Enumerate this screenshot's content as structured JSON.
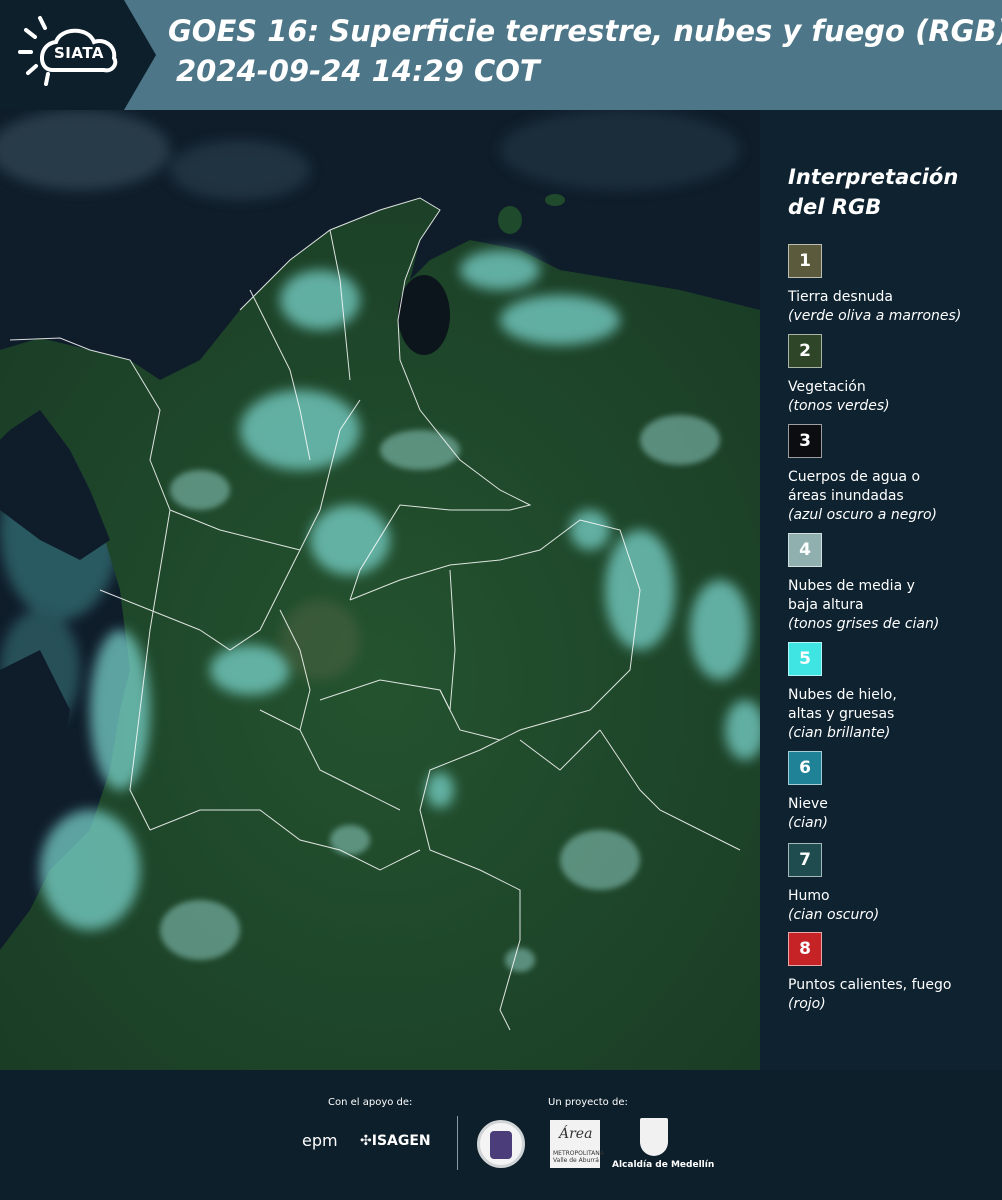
{
  "header": {
    "title_line1": "GOES 16: Superficie terrestre, nubes y fuego (RGB)",
    "title_line2": "2024-09-24 14:29 COT",
    "logo_text": "SIATA",
    "background_color": "#4d7788"
  },
  "legend": {
    "title": "Interpretación del RGB",
    "items": [
      {
        "number": "1",
        "label": "Tierra desnuda",
        "desc": "(verde oliva a marrones)",
        "color": "#5b5a3d"
      },
      {
        "number": "2",
        "label": "Vegetación",
        "desc": "(tonos verdes)",
        "color": "#2f4527"
      },
      {
        "number": "3",
        "label": "Cuerpos de agua o\náreas inundadas",
        "desc": "(azul oscuro a negro)",
        "color": "#0b0d10"
      },
      {
        "number": "4",
        "label": "Nubes de media y\nbaja altura",
        "desc": "(tonos grises de cian)",
        "color": "#8fb0ae"
      },
      {
        "number": "5",
        "label": "Nubes de hielo,\naltas y gruesas",
        "desc": "(cian brillante)",
        "color": "#3fe5e3"
      },
      {
        "number": "6",
        "label": "Nieve",
        "desc": "(cian)",
        "color": "#1f8296"
      },
      {
        "number": "7",
        "label": "Humo",
        "desc": "(cian oscuro)",
        "color": "#1f4d4f"
      },
      {
        "number": "8",
        "label": "Puntos calientes, fuego",
        "desc": "(rojo)",
        "color": "#c62327"
      }
    ]
  },
  "footer": {
    "support_label": "Con el apoyo de:",
    "project_label": "Un proyecto de:",
    "partners": [
      "epm",
      "ISAGEN"
    ],
    "area_logo_word": "Área",
    "area_logo_small": "METROPOLITANA Valle de Aburrá",
    "alcaldia": "Alcaldía de Medellín"
  },
  "colors": {
    "land": "#1f4a2c",
    "ocean": "#0f1d2a",
    "cloud": "#7fdcd6",
    "border": "#ffffff"
  }
}
